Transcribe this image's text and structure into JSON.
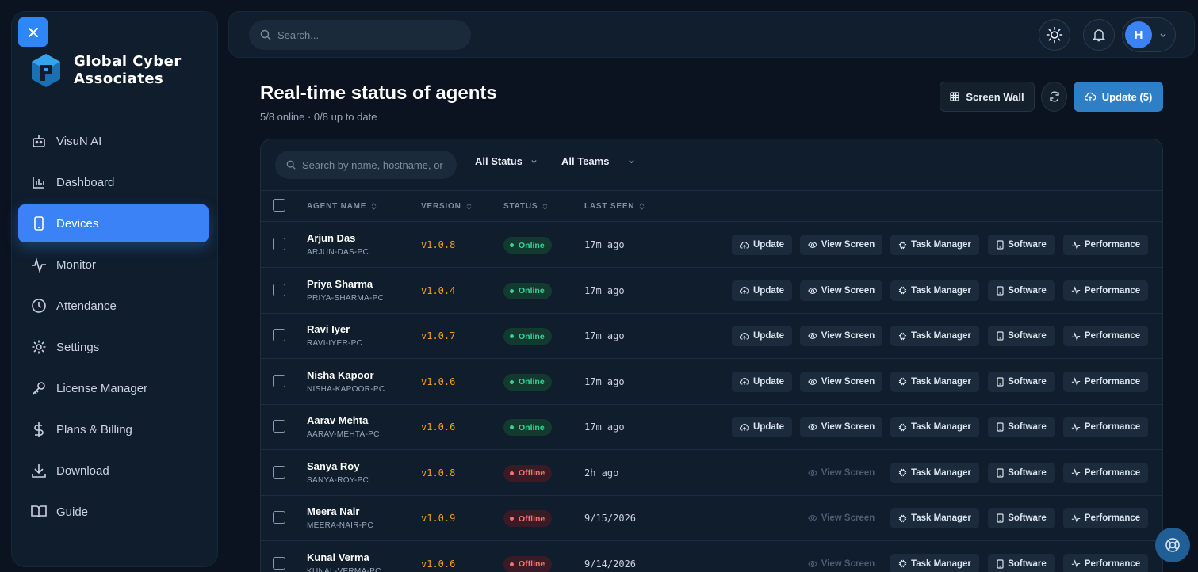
{
  "brand": {
    "name_line1": "Global Cyber",
    "name_line2": "Associates"
  },
  "sidebar": {
    "items": [
      {
        "label": "VisuN AI",
        "icon": "robot-icon",
        "active": false
      },
      {
        "label": "Dashboard",
        "icon": "chart-icon",
        "active": false
      },
      {
        "label": "Devices",
        "icon": "device-icon",
        "active": true
      },
      {
        "label": "Monitor",
        "icon": "activity-icon",
        "active": false
      },
      {
        "label": "Attendance",
        "icon": "clock-icon",
        "active": false
      },
      {
        "label": "Settings",
        "icon": "gear-icon",
        "active": false
      },
      {
        "label": "License Manager",
        "icon": "key-icon",
        "active": false
      },
      {
        "label": "Plans & Billing",
        "icon": "dollar-icon",
        "active": false
      },
      {
        "label": "Download",
        "icon": "download-icon",
        "active": false
      },
      {
        "label": "Guide",
        "icon": "book-icon",
        "active": false
      }
    ]
  },
  "topbar": {
    "search_placeholder": "Search...",
    "avatar_initial": "H"
  },
  "page": {
    "title": "Real-time status of agents",
    "subtitle": "5/8 online · 0/8 up to date",
    "screen_wall_label": "Screen Wall",
    "update_label": "Update (5)"
  },
  "table": {
    "search_placeholder": "Search by name, hostname, or",
    "status_filter": "All Status",
    "teams_filter": "All Teams",
    "columns": {
      "agent_name": "AGENT NAME",
      "version": "VERSION",
      "status": "STATUS",
      "last_seen": "LAST SEEN"
    },
    "actions": {
      "update": "Update",
      "view_screen": "View Screen",
      "task_manager": "Task Manager",
      "software": "Software",
      "performance": "Performance"
    },
    "rows": [
      {
        "name": "Arjun Das",
        "host": "ARJUN-DAS-PC",
        "version": "v1.0.8",
        "status": "Online",
        "last_seen": "17m ago"
      },
      {
        "name": "Priya Sharma",
        "host": "PRIYA-SHARMA-PC",
        "version": "v1.0.4",
        "status": "Online",
        "last_seen": "17m ago"
      },
      {
        "name": "Ravi Iyer",
        "host": "RAVI-IYER-PC",
        "version": "v1.0.7",
        "status": "Online",
        "last_seen": "17m ago"
      },
      {
        "name": "Nisha Kapoor",
        "host": "NISHA-KAPOOR-PC",
        "version": "v1.0.6",
        "status": "Online",
        "last_seen": "17m ago"
      },
      {
        "name": "Aarav Mehta",
        "host": "AARAV-MEHTA-PC",
        "version": "v1.0.6",
        "status": "Online",
        "last_seen": "17m ago"
      },
      {
        "name": "Sanya Roy",
        "host": "SANYA-ROY-PC",
        "version": "v1.0.8",
        "status": "Offline",
        "last_seen": "2h ago"
      },
      {
        "name": "Meera Nair",
        "host": "MEERA-NAIR-PC",
        "version": "v1.0.9",
        "status": "Offline",
        "last_seen": "9/15/2026"
      },
      {
        "name": "Kunal Verma",
        "host": "KUNAL-VERMA-PC",
        "version": "v1.0.6",
        "status": "Offline",
        "last_seen": "9/14/2026"
      }
    ]
  },
  "colors": {
    "accent": "#3b82f6",
    "online": "#34d399",
    "offline": "#f87171",
    "version": "#f59e0b"
  }
}
